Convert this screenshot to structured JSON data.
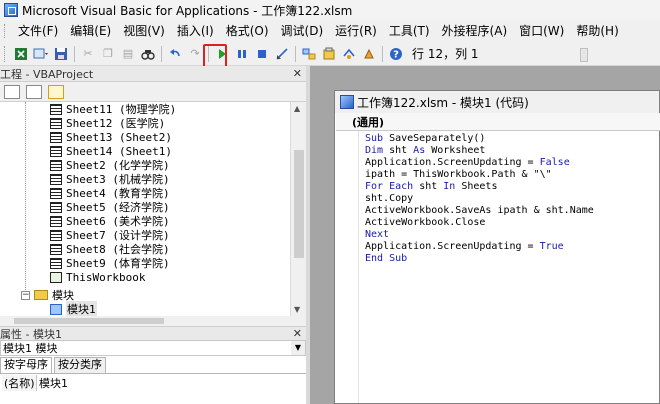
{
  "titlebar": {
    "title": "Microsoft Visual Basic for Applications - 工作簿122.xlsm"
  },
  "menu": [
    "文件(F)",
    "编辑(E)",
    "视图(V)",
    "插入(I)",
    "格式(O)",
    "调试(D)",
    "运行(R)",
    "工具(T)",
    "外接程序(A)",
    "窗口(W)",
    "帮助(H)"
  ],
  "toolbar": {
    "icons": [
      "excel-icon",
      "insert-object-icon",
      "save-icon",
      "cut-icon",
      "copy-icon",
      "paste-icon",
      "find-icon",
      "undo-icon",
      "redo-icon",
      "run-icon",
      "break-icon",
      "reset-icon",
      "design-mode-icon",
      "project-explorer-icon",
      "properties-icon",
      "object-browser-icon",
      "toolbox-icon",
      "help-icon"
    ],
    "run_glyph": "▶",
    "position": "行 12，列 1",
    "highlight_color": "#e02020"
  },
  "project_pane": {
    "title": "工程 - VBAProject",
    "items": [
      {
        "label": "Sheet11 (物理学院)",
        "type": "sheet"
      },
      {
        "label": "Sheet12 (医学院)",
        "type": "sheet"
      },
      {
        "label": "Sheet13 (Sheet2)",
        "type": "sheet"
      },
      {
        "label": "Sheet14 (Sheet1)",
        "type": "sheet"
      },
      {
        "label": "Sheet2 (化学学院)",
        "type": "sheet"
      },
      {
        "label": "Sheet3 (机械学院)",
        "type": "sheet"
      },
      {
        "label": "Sheet4 (教育学院)",
        "type": "sheet"
      },
      {
        "label": "Sheet5 (经济学院)",
        "type": "sheet"
      },
      {
        "label": "Sheet6 (美术学院)",
        "type": "sheet"
      },
      {
        "label": "Sheet7 (设计学院)",
        "type": "sheet"
      },
      {
        "label": "Sheet8 (社会学院)",
        "type": "sheet"
      },
      {
        "label": "Sheet9 (体育学院)",
        "type": "sheet"
      },
      {
        "label": "ThisWorkbook",
        "type": "workbook"
      }
    ],
    "folder": "模块",
    "module": "模块1"
  },
  "properties_pane": {
    "title": "属性 - 模块1",
    "object": "模块1 模块",
    "tabs": [
      "按字母序",
      "按分类序"
    ],
    "prop_name": "(名称)",
    "prop_value": "模块1"
  },
  "code_window": {
    "title": "工作簿122.xlsm - 模块1 (代码)",
    "object_combo": "(通用)",
    "lines": [
      [
        "Sub",
        " SaveSeparately()"
      ],
      [
        "Dim",
        " sht ",
        "As",
        " Worksheet"
      ],
      [
        "",
        "Application.ScreenUpdating = ",
        "False"
      ],
      [
        "",
        "ipath = ThisWorkbook.Path & \"\\\""
      ],
      [
        "For Each",
        " sht ",
        "In",
        " Sheets"
      ],
      [
        "",
        "sht.Copy"
      ],
      [
        "",
        "ActiveWorkbook.SaveAs ipath & sht.Name"
      ],
      [
        "",
        "ActiveWorkbook.Close"
      ],
      [
        "Next",
        ""
      ],
      [
        "",
        "Application.ScreenUpdating = ",
        "True"
      ],
      [
        "End Sub",
        ""
      ]
    ]
  }
}
